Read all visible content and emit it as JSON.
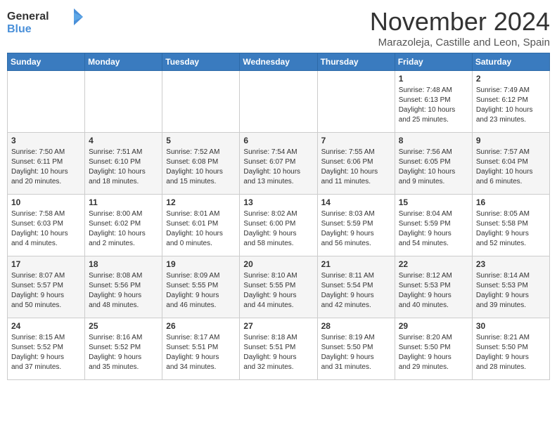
{
  "header": {
    "logo_general": "General",
    "logo_blue": "Blue",
    "month": "November 2024",
    "location": "Marazoleja, Castille and Leon, Spain"
  },
  "weekdays": [
    "Sunday",
    "Monday",
    "Tuesday",
    "Wednesday",
    "Thursday",
    "Friday",
    "Saturday"
  ],
  "weeks": [
    [
      {
        "day": "",
        "info": ""
      },
      {
        "day": "",
        "info": ""
      },
      {
        "day": "",
        "info": ""
      },
      {
        "day": "",
        "info": ""
      },
      {
        "day": "",
        "info": ""
      },
      {
        "day": "1",
        "info": "Sunrise: 7:48 AM\nSunset: 6:13 PM\nDaylight: 10 hours\nand 25 minutes."
      },
      {
        "day": "2",
        "info": "Sunrise: 7:49 AM\nSunset: 6:12 PM\nDaylight: 10 hours\nand 23 minutes."
      }
    ],
    [
      {
        "day": "3",
        "info": "Sunrise: 7:50 AM\nSunset: 6:11 PM\nDaylight: 10 hours\nand 20 minutes."
      },
      {
        "day": "4",
        "info": "Sunrise: 7:51 AM\nSunset: 6:10 PM\nDaylight: 10 hours\nand 18 minutes."
      },
      {
        "day": "5",
        "info": "Sunrise: 7:52 AM\nSunset: 6:08 PM\nDaylight: 10 hours\nand 15 minutes."
      },
      {
        "day": "6",
        "info": "Sunrise: 7:54 AM\nSunset: 6:07 PM\nDaylight: 10 hours\nand 13 minutes."
      },
      {
        "day": "7",
        "info": "Sunrise: 7:55 AM\nSunset: 6:06 PM\nDaylight: 10 hours\nand 11 minutes."
      },
      {
        "day": "8",
        "info": "Sunrise: 7:56 AM\nSunset: 6:05 PM\nDaylight: 10 hours\nand 9 minutes."
      },
      {
        "day": "9",
        "info": "Sunrise: 7:57 AM\nSunset: 6:04 PM\nDaylight: 10 hours\nand 6 minutes."
      }
    ],
    [
      {
        "day": "10",
        "info": "Sunrise: 7:58 AM\nSunset: 6:03 PM\nDaylight: 10 hours\nand 4 minutes."
      },
      {
        "day": "11",
        "info": "Sunrise: 8:00 AM\nSunset: 6:02 PM\nDaylight: 10 hours\nand 2 minutes."
      },
      {
        "day": "12",
        "info": "Sunrise: 8:01 AM\nSunset: 6:01 PM\nDaylight: 10 hours\nand 0 minutes."
      },
      {
        "day": "13",
        "info": "Sunrise: 8:02 AM\nSunset: 6:00 PM\nDaylight: 9 hours\nand 58 minutes."
      },
      {
        "day": "14",
        "info": "Sunrise: 8:03 AM\nSunset: 5:59 PM\nDaylight: 9 hours\nand 56 minutes."
      },
      {
        "day": "15",
        "info": "Sunrise: 8:04 AM\nSunset: 5:59 PM\nDaylight: 9 hours\nand 54 minutes."
      },
      {
        "day": "16",
        "info": "Sunrise: 8:05 AM\nSunset: 5:58 PM\nDaylight: 9 hours\nand 52 minutes."
      }
    ],
    [
      {
        "day": "17",
        "info": "Sunrise: 8:07 AM\nSunset: 5:57 PM\nDaylight: 9 hours\nand 50 minutes."
      },
      {
        "day": "18",
        "info": "Sunrise: 8:08 AM\nSunset: 5:56 PM\nDaylight: 9 hours\nand 48 minutes."
      },
      {
        "day": "19",
        "info": "Sunrise: 8:09 AM\nSunset: 5:55 PM\nDaylight: 9 hours\nand 46 minutes."
      },
      {
        "day": "20",
        "info": "Sunrise: 8:10 AM\nSunset: 5:55 PM\nDaylight: 9 hours\nand 44 minutes."
      },
      {
        "day": "21",
        "info": "Sunrise: 8:11 AM\nSunset: 5:54 PM\nDaylight: 9 hours\nand 42 minutes."
      },
      {
        "day": "22",
        "info": "Sunrise: 8:12 AM\nSunset: 5:53 PM\nDaylight: 9 hours\nand 40 minutes."
      },
      {
        "day": "23",
        "info": "Sunrise: 8:14 AM\nSunset: 5:53 PM\nDaylight: 9 hours\nand 39 minutes."
      }
    ],
    [
      {
        "day": "24",
        "info": "Sunrise: 8:15 AM\nSunset: 5:52 PM\nDaylight: 9 hours\nand 37 minutes."
      },
      {
        "day": "25",
        "info": "Sunrise: 8:16 AM\nSunset: 5:52 PM\nDaylight: 9 hours\nand 35 minutes."
      },
      {
        "day": "26",
        "info": "Sunrise: 8:17 AM\nSunset: 5:51 PM\nDaylight: 9 hours\nand 34 minutes."
      },
      {
        "day": "27",
        "info": "Sunrise: 8:18 AM\nSunset: 5:51 PM\nDaylight: 9 hours\nand 32 minutes."
      },
      {
        "day": "28",
        "info": "Sunrise: 8:19 AM\nSunset: 5:50 PM\nDaylight: 9 hours\nand 31 minutes."
      },
      {
        "day": "29",
        "info": "Sunrise: 8:20 AM\nSunset: 5:50 PM\nDaylight: 9 hours\nand 29 minutes."
      },
      {
        "day": "30",
        "info": "Sunrise: 8:21 AM\nSunset: 5:50 PM\nDaylight: 9 hours\nand 28 minutes."
      }
    ]
  ]
}
